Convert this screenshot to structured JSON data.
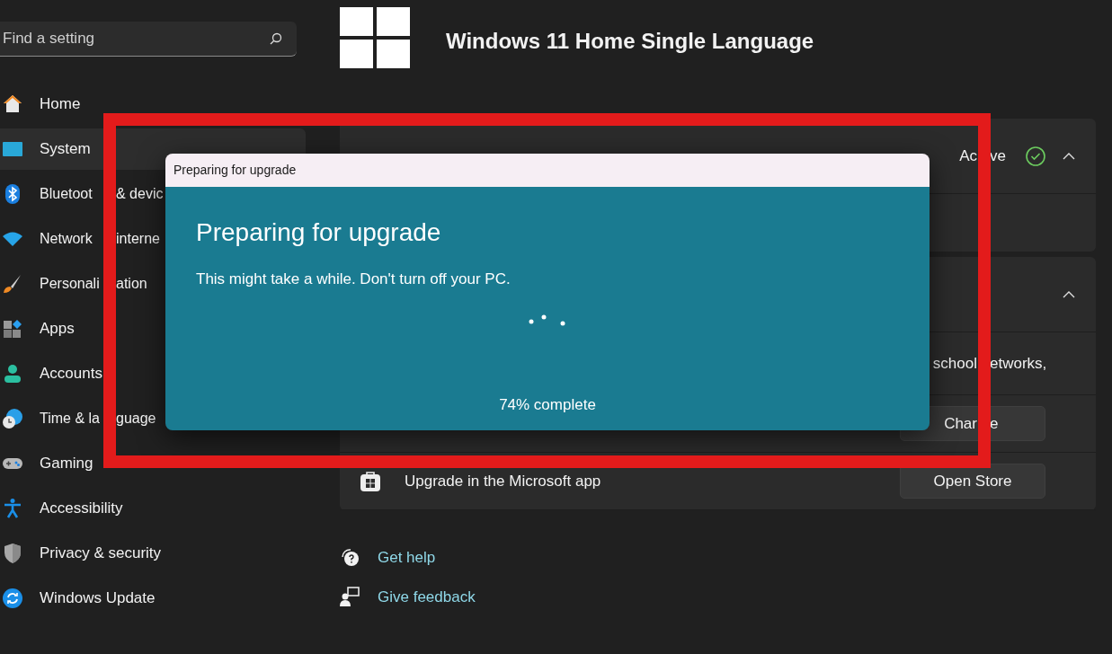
{
  "search": {
    "placeholder": "Find a setting"
  },
  "sidebar": {
    "items": [
      {
        "label": "Home",
        "selected": false
      },
      {
        "label": "System",
        "selected": true
      },
      {
        "label": "Bluetoot",
        "label_after_frame": "& devic",
        "selected": false
      },
      {
        "label": "Network",
        "label_after_frame": "interne",
        "selected": false
      },
      {
        "label": "Personali",
        "label_after_frame": "ation",
        "selected": false
      },
      {
        "label": "Apps",
        "selected": false
      },
      {
        "label": "Accounts",
        "selected": false
      },
      {
        "label": "Time & la",
        "label_after_frame": "guage",
        "selected": false
      },
      {
        "label": "Gaming",
        "selected": false
      },
      {
        "label": "Accessibility",
        "selected": false
      },
      {
        "label": "Privacy & security",
        "selected": false
      },
      {
        "label": "Windows Update",
        "selected": false
      }
    ]
  },
  "header": {
    "title": "Windows 11 Home Single Language"
  },
  "activation_card": {
    "status": "Ac",
    "status_after_frame": "ve",
    "expanded": true
  },
  "upgrade_card": {
    "expanded": true,
    "description": "school",
    "description_after_frame": "etworks,",
    "rows": [
      {
        "button": "Char",
        "button_after_frame": "e"
      },
      {
        "label": "Upgrade in the Microsoft app",
        "button": "Open Store"
      }
    ]
  },
  "links": [
    {
      "label": "Get help"
    },
    {
      "label": "Give feedback"
    }
  ],
  "dialog": {
    "title": "Preparing for upgrade",
    "heading": "Preparing for upgrade",
    "message": "This might take a while. Don't turn off your PC.",
    "progress": "74% complete"
  }
}
